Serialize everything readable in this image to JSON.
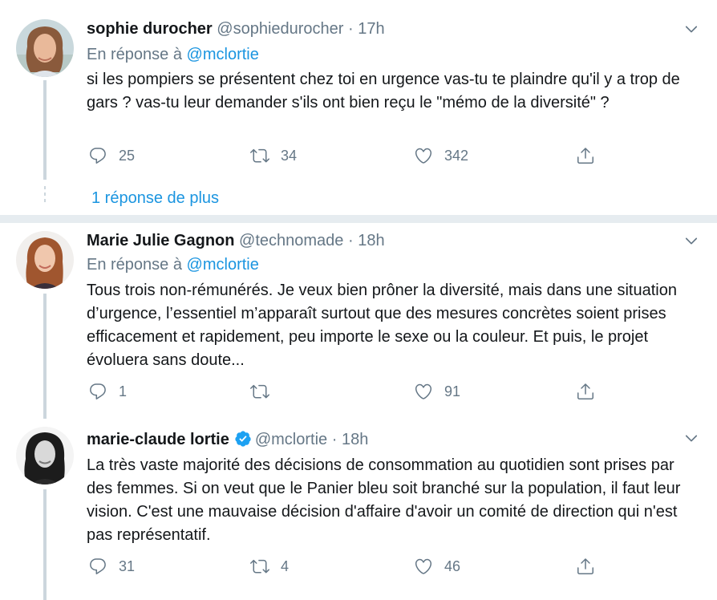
{
  "tweets": [
    {
      "name": "sophie durocher",
      "handle": "@sophiedurocher",
      "separator": "·",
      "time": "17h",
      "reply_prefix": "En réponse à",
      "reply_handle": "@mclortie",
      "text": "si les pompiers se présentent chez toi en urgence vas-tu te plaindre qu'il y a trop de gars ? vas-tu leur demander s'ils ont bien reçu le \"mémo de la diversité\" ?",
      "replies": "25",
      "retweets": "34",
      "likes": "342",
      "more_replies": "1 réponse de plus"
    },
    {
      "name": "Marie Julie Gagnon",
      "handle": "@technomade",
      "separator": "·",
      "time": "18h",
      "reply_prefix": "En réponse à",
      "reply_handle": "@mclortie",
      "text": "Tous trois non-rémunérés. Je veux bien prôner la diversité, mais dans une situation d’urgence, l’essentiel m’apparaît surtout que des mesures concrètes soient prises efficacement et rapidement, peu importe le sexe ou la couleur. Et puis, le projet évoluera sans doute...",
      "replies": "1",
      "retweets": "",
      "likes": "91"
    },
    {
      "name": "marie-claude lortie",
      "verified": true,
      "handle": "@mclortie",
      "separator": "·",
      "time": "18h",
      "text": "La très vaste majorité des décisions de consommation au quotidien sont prises par des femmes. Si on veut que le Panier bleu soit branché sur la population, il faut leur vision. C'est une mauvaise décision d'affaire d'avoir un comité de direction qui n'est pas représentatif.",
      "replies": "31",
      "retweets": "4",
      "likes": "46"
    }
  ],
  "colors": {
    "link": "#1b95e0",
    "muted": "#657786",
    "text": "#14171a",
    "divider": "#e6ecf0",
    "verified": "#1da1f2"
  },
  "icons": [
    "reply-icon",
    "retweet-icon",
    "like-icon",
    "share-icon",
    "chevron-down-icon",
    "verified-badge-icon"
  ]
}
